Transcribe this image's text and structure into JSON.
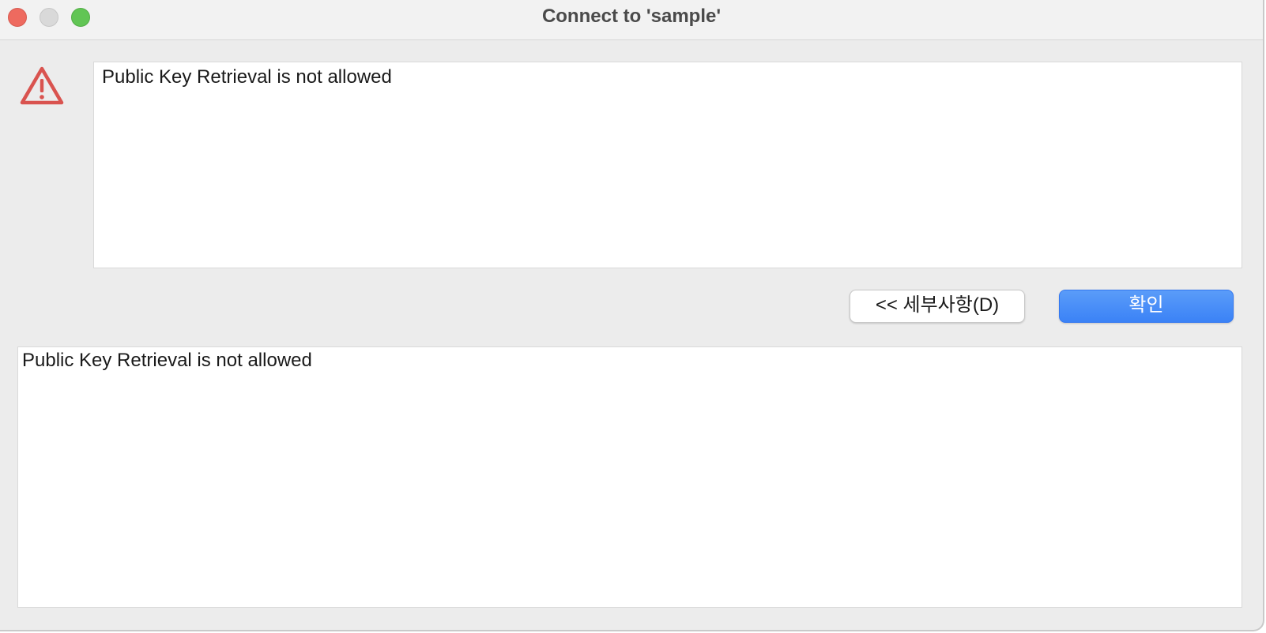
{
  "window": {
    "title": "Connect to 'sample'"
  },
  "dialog": {
    "icon": "warning-icon",
    "message": "Public Key Retrieval is not allowed",
    "details_text": "Public Key Retrieval is not allowed"
  },
  "buttons": {
    "details_label": "<< 세부사항(D)",
    "ok_label": "확인"
  },
  "colors": {
    "accent": "#3b82f6",
    "warning": "#d9534f",
    "close": "#ee6a5f",
    "minimize": "#d9d9d9",
    "zoom": "#61c554"
  }
}
